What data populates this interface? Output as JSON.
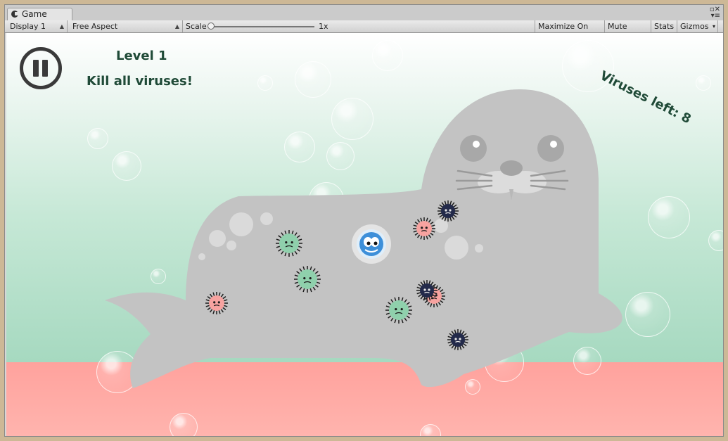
{
  "tab": {
    "label": "Game"
  },
  "toolbar": {
    "display": "Display 1",
    "aspect": "Free Aspect",
    "scale_label": "Scale",
    "scale_value": "1x",
    "maximize": "Maximize On Play",
    "mute": "Mute Audio",
    "stats": "Stats",
    "gizmos": "Gizmos"
  },
  "hud": {
    "level": "Level 1",
    "goal": "Kill all viruses!",
    "viruses_left": "Viruses left: 8"
  },
  "colors": {
    "seal": "#c3c3c3",
    "hud_text": "#1f4a37",
    "virus_green": "#8fd0ac",
    "virus_red": "#f7a3a0",
    "virus_navy": "#232a4a",
    "player": "#3d8fd9",
    "ground": "#ffa8a3"
  },
  "icons": {
    "pause": "pause-icon",
    "player": "white-blood-cell-icon",
    "virus": "spiky-virus-icon"
  }
}
